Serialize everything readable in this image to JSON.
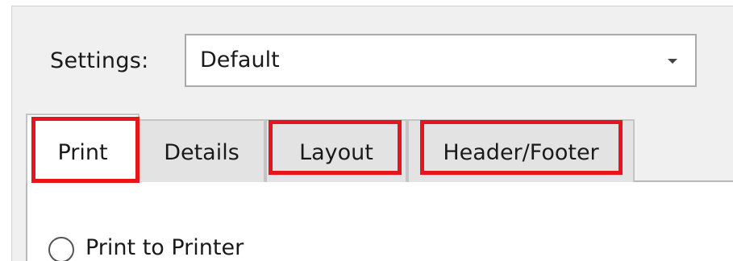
{
  "settings": {
    "label": "Settings:",
    "selected_value": "Default"
  },
  "tabs": [
    {
      "label": "Print",
      "active": true
    },
    {
      "label": "Details",
      "active": false
    },
    {
      "label": "Layout",
      "active": false
    },
    {
      "label": "Header/Footer",
      "active": false
    }
  ],
  "print_options": {
    "print_to_printer_label": "Print to Printer"
  },
  "colors": {
    "highlight": "#e8141c",
    "tab_inactive": "#e3e3e3",
    "dialog_background": "#f0f0f0"
  }
}
